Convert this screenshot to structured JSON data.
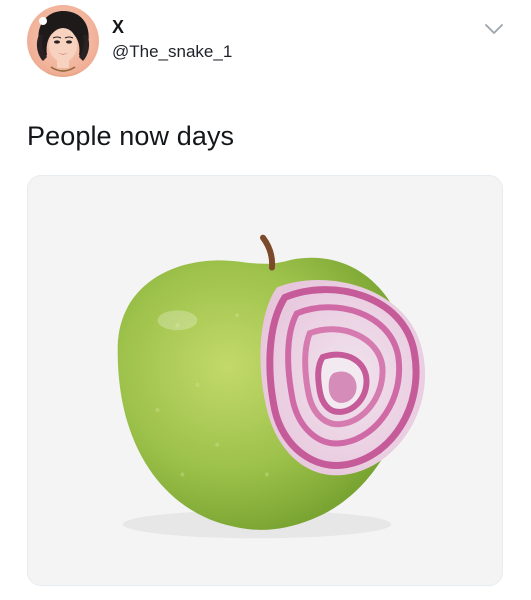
{
  "user": {
    "display_name": "X",
    "handle": "@The_snake_1",
    "avatar_icon": "profile-avatar-woman-illustration"
  },
  "tweet": {
    "text": "People now days"
  },
  "menu": {
    "icon": "chevron-down-icon"
  },
  "media": {
    "description_icon": "apple-with-onion-slice-image"
  },
  "colors": {
    "text": "#14171a",
    "media_bg": "#f4f4f4",
    "apple_green": "#9cc14a",
    "onion_pink": "#c65b9a"
  }
}
